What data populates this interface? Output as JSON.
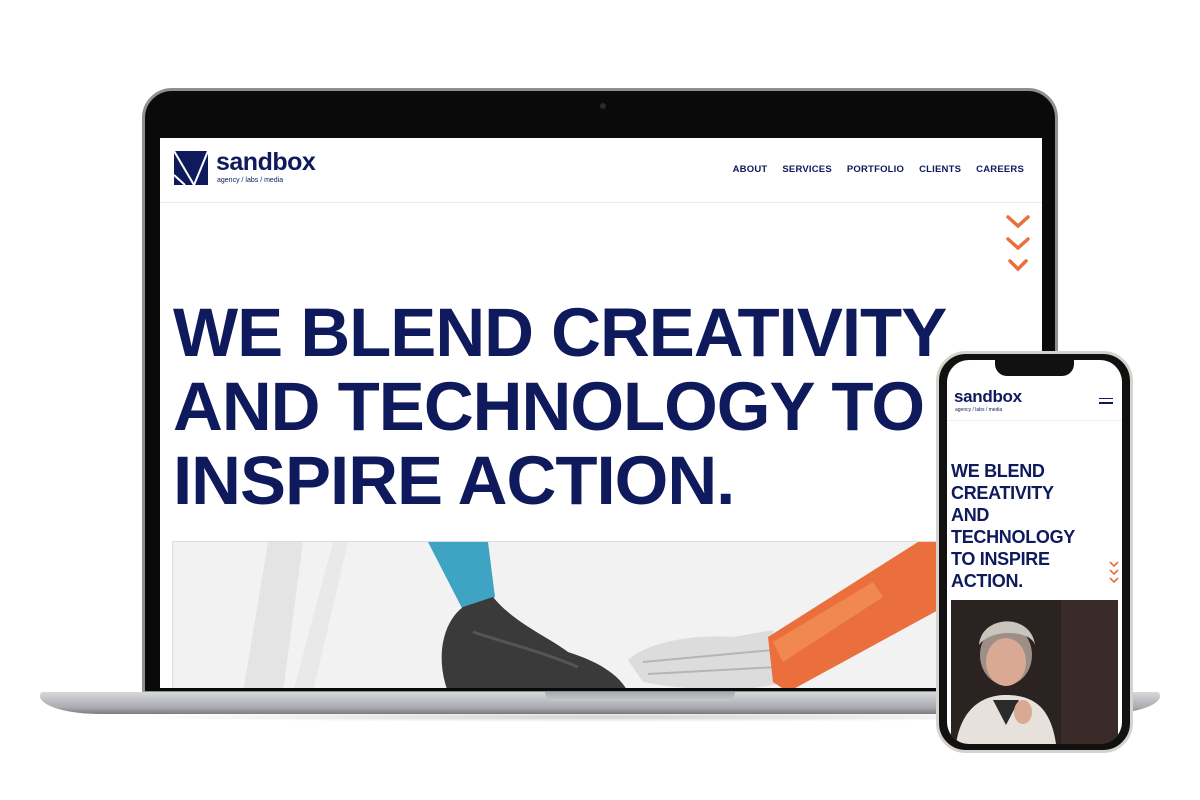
{
  "desktop": {
    "logo": {
      "word": "sandbox",
      "tagline": "agency / labs / media"
    },
    "nav": [
      {
        "label": "ABOUT"
      },
      {
        "label": "SERVICES"
      },
      {
        "label": "PORTFOLIO"
      },
      {
        "label": "CLIENTS"
      },
      {
        "label": "CAREERS"
      }
    ],
    "hero": {
      "line1": "WE BLEND CREATIVITY",
      "line2": "AND TECHNOLOGY TO",
      "line3": "INSPIRE ACTION."
    }
  },
  "mobile": {
    "logo": {
      "word": "sandbox",
      "tagline": "agency / labs / media"
    },
    "hero_lines": [
      "WE BLEND",
      "CREATIVITY",
      "AND",
      "TECHNOLOGY",
      "TO INSPIRE",
      "ACTION."
    ]
  },
  "colors": {
    "brand_navy": "#0e1a5c",
    "accent_orange": "#ea6f3c",
    "accent_teal": "#3fa3c3"
  },
  "icons": [
    "sandbox-logo-mark-icon",
    "chevron-down-icon",
    "hamburger-menu-icon"
  ]
}
